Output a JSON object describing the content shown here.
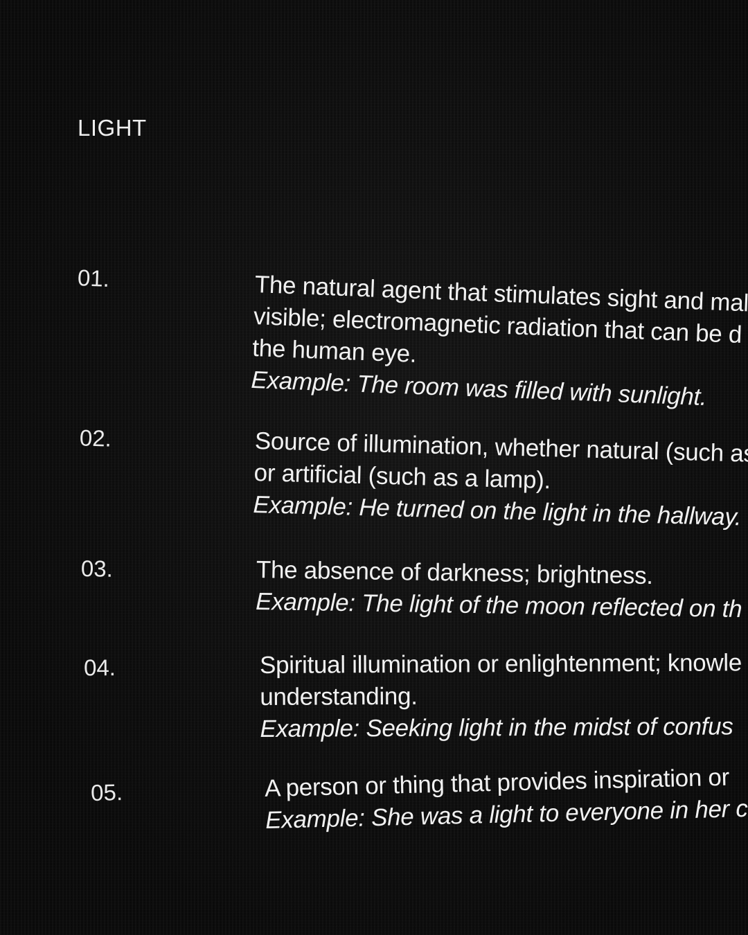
{
  "title": "LIGHT",
  "entries": [
    {
      "number": "01.",
      "definition_lines": [
        "The natural agent that stimulates sight and mal",
        "visible; electromagnetic radiation that can be d",
        "the human eye."
      ],
      "example": "Example: The room was filled with sunlight."
    },
    {
      "number": "02.",
      "definition_lines": [
        "Source of illumination, whether natural (such as",
        "or artificial (such as a lamp)."
      ],
      "example": "Example: He turned on the light in the hallway."
    },
    {
      "number": "03.",
      "definition_lines": [
        "The absence of darkness; brightness."
      ],
      "example": "Example: The light of the moon reflected on th"
    },
    {
      "number": "04.",
      "definition_lines": [
        "Spiritual illumination or enlightenment; knowle",
        "understanding."
      ],
      "example": "Example: Seeking light in the midst of confus"
    },
    {
      "number": "05.",
      "definition_lines": [
        "A person or thing that provides inspiration or"
      ],
      "example": "Example: She was a light to everyone in her c"
    }
  ]
}
